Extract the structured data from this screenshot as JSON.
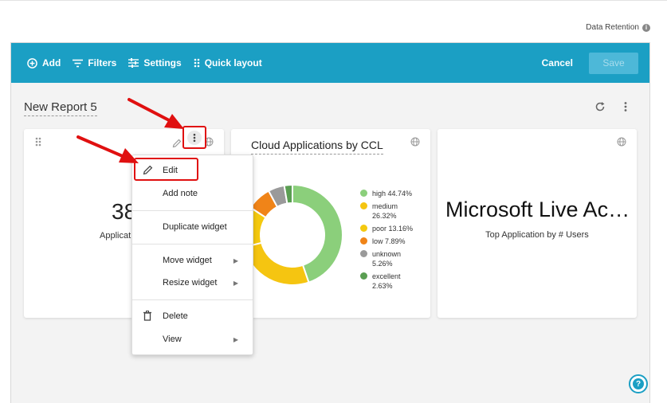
{
  "header": {
    "data_retention_label": "Data Retention",
    "info_glyph": "i"
  },
  "toolbar": {
    "add_label": "Add",
    "filters_label": "Filters",
    "settings_label": "Settings",
    "quick_layout_label": "Quick layout",
    "cancel_label": "Cancel",
    "save_label": "Save"
  },
  "report": {
    "title": "New Report 5"
  },
  "widgets": {
    "metric": {
      "value": "38",
      "label": "Applicat"
    },
    "ccl_chart": {
      "title": "Cloud Applications by CCL"
    },
    "top_app": {
      "name": "Microsoft Live Ac…",
      "subtitle": "Top Application by # Users"
    }
  },
  "chart_data": {
    "type": "pie",
    "title": "Cloud Applications by CCL",
    "donut": true,
    "legend_position": "right",
    "series": [
      {
        "name": "high",
        "label": "high 44.74%",
        "value": 44.74,
        "color": "#8bcf7b"
      },
      {
        "name": "medium",
        "label": "medium 26.32%",
        "value": 26.32,
        "color": "#f5c511"
      },
      {
        "name": "poor",
        "label": "poor 13.16%",
        "value": 13.16,
        "color": "#f4c90f"
      },
      {
        "name": "low",
        "label": "low 7.89%",
        "value": 7.89,
        "color": "#f08418"
      },
      {
        "name": "unknown",
        "label": "unknown 5.26%",
        "value": 5.26,
        "color": "#9a9a9a"
      },
      {
        "name": "excellent",
        "label": "excellent 2.63%",
        "value": 2.63,
        "color": "#5a9e52"
      }
    ]
  },
  "context_menu": {
    "edit": "Edit",
    "add_note": "Add note",
    "duplicate_widget": "Duplicate widget",
    "move_widget": "Move widget",
    "resize_widget": "Resize widget",
    "delete": "Delete",
    "view": "View",
    "submenu_arrow": "▶"
  },
  "help": {
    "glyph": "?"
  },
  "icons": {
    "add": "plus-circle-icon",
    "filters": "filter-lines-icon",
    "settings": "sliders-icon",
    "quick_layout": "drag-grid-icon",
    "refresh": "refresh-icon",
    "kebab": "kebab-icon",
    "globe": "globe-icon",
    "pencil": "pencil-icon",
    "trash": "trash-icon",
    "help": "help-icon"
  },
  "colors": {
    "toolbar": "#1b9fc4",
    "annotation": "#e01010"
  }
}
